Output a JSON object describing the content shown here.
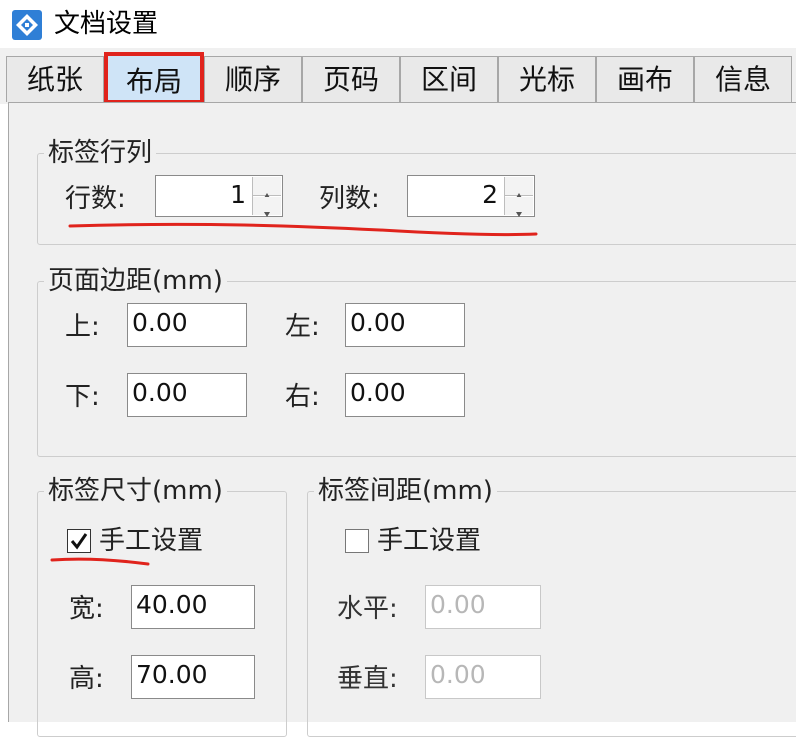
{
  "window": {
    "title": "文档设置",
    "icon": "app-logo-icon"
  },
  "tabs": [
    {
      "label": "纸张",
      "active": false
    },
    {
      "label": "布局",
      "active": true
    },
    {
      "label": "顺序",
      "active": false
    },
    {
      "label": "页码",
      "active": false
    },
    {
      "label": "区间",
      "active": false
    },
    {
      "label": "光标",
      "active": false
    },
    {
      "label": "画布",
      "active": false
    },
    {
      "label": "信息",
      "active": false
    }
  ],
  "label_rows_cols": {
    "title": "标签行列",
    "rows_label": "行数:",
    "rows_value": "1",
    "cols_label": "列数:",
    "cols_value": "2"
  },
  "page_margins": {
    "title": "页面边距(mm)",
    "top_label": "上:",
    "top_value": "0.00",
    "left_label": "左:",
    "left_value": "0.00",
    "bottom_label": "下:",
    "bottom_value": "0.00",
    "right_label": "右:",
    "right_value": "0.00"
  },
  "label_size": {
    "title": "标签尺寸(mm)",
    "manual_label": "手工设置",
    "manual_checked": true,
    "width_label": "宽:",
    "width_value": "40.00",
    "height_label": "高:",
    "height_value": "70.00"
  },
  "label_spacing": {
    "title": "标签间距(mm)",
    "manual_label": "手工设置",
    "manual_checked": false,
    "horizontal_label": "水平:",
    "horizontal_value": "0.00",
    "vertical_label": "垂直:",
    "vertical_value": "0.00"
  },
  "colors": {
    "annotation_red": "#e0231c",
    "active_tab_bg": "#cfe4f7",
    "panel_bg": "#f0f0f0"
  }
}
